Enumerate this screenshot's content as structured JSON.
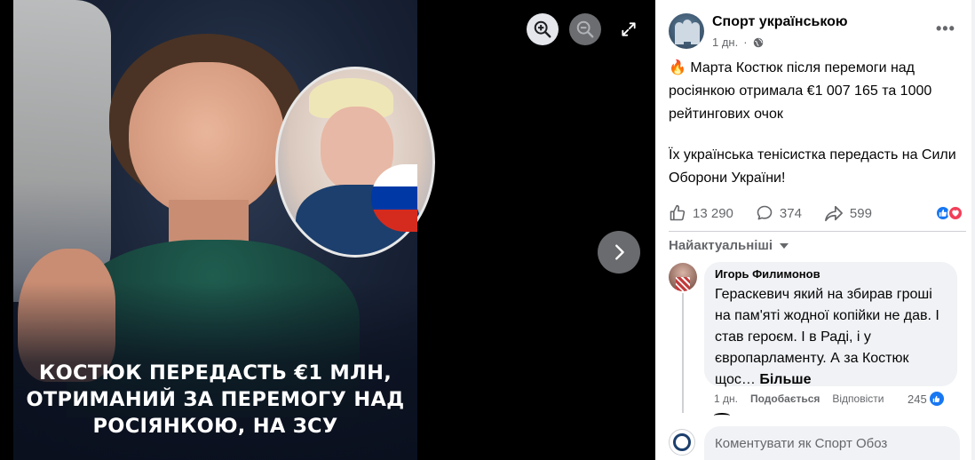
{
  "viewer": {
    "caption_lines": [
      "Костюк передасть €1 млн,",
      "отриманий за перемогу над",
      "росіянкою, на ЗСУ"
    ],
    "controls": [
      "zoom-in-icon",
      "zoom-out-icon",
      "expand-icon",
      "chevron-right-icon"
    ],
    "flag_colors": [
      "#ffffff",
      "#0039a6",
      "#d52b1e"
    ]
  },
  "post": {
    "page_name": "Спорт українською",
    "time": "1 дн.",
    "audience_icon": "globe-icon",
    "text_paragraph_1": "🔥 Марта Костюк після перемоги над росіянкою отримала €1 007 165 та 1000 рейтингових очок",
    "text_paragraph_2": "Їх українська тенісистка передасть на Сили Оборони України!",
    "likes": "13 290",
    "comments": "374",
    "shares": "599",
    "reaction_icons": [
      "like-icon",
      "love-icon"
    ]
  },
  "comments": {
    "sort_label": "Найактуальніші",
    "items": [
      {
        "author": "Игорь Филимонов",
        "text": "Гераскевич який на збирав гроші на пам'яті жодної копійки не дав. І став героєм. І в Раді, і у європарламенту. А за Костюк щос…",
        "more": "Більше",
        "time": "1 дн.",
        "like_label": "Подобається",
        "reply_label": "Відповісти",
        "reactions_count": "245"
      }
    ],
    "input_placeholder": "Коментувати як Спорт Обоз"
  },
  "colors": {
    "accent": "#1877f2",
    "love": "#f33e58",
    "muted_text": "#65676b"
  }
}
